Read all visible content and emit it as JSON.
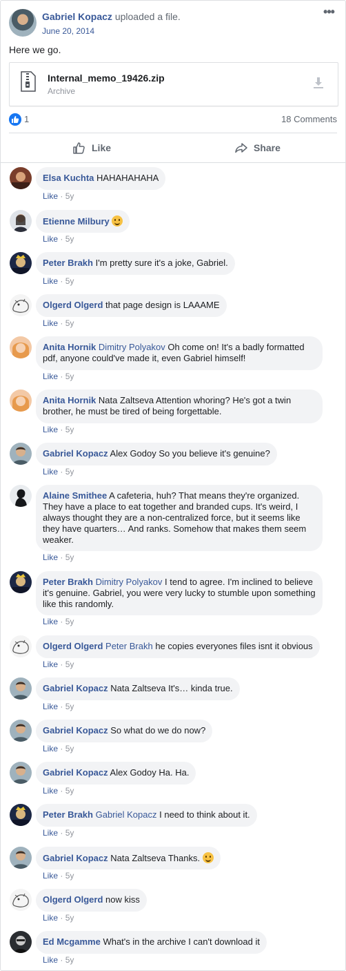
{
  "post": {
    "author": "Gabriel Kopacz",
    "action": "uploaded a file.",
    "date": "June 20, 2014",
    "text": "Here we go.",
    "file_name": "Internal_memo_19426.zip",
    "file_type": "Archive",
    "like_count": "1",
    "comment_count": "18 Comments",
    "like_label": "Like",
    "share_label": "Share",
    "more_label": "•••"
  },
  "comments": [
    {
      "author": "Elsa Kuchta",
      "mention": "",
      "text": "HAHAHAHAHA",
      "like": "Like",
      "time": "5y"
    },
    {
      "author": "Etienne Milbury",
      "mention": "",
      "text": "",
      "like": "Like",
      "time": "5y"
    },
    {
      "author": "Peter Brakh",
      "mention": "",
      "text": "I'm pretty sure it's a joke, Gabriel.",
      "like": "Like",
      "time": "5y"
    },
    {
      "author": "Olgerd Olgerd",
      "mention": "",
      "text": "that page design is LAAAME",
      "like": "Like",
      "time": "5y"
    },
    {
      "author": "Anita Hornik",
      "mention": "Dimitry Polyakov",
      "text": "Oh come on! It's a badly formatted pdf, anyone could've made it, even Gabriel himself!",
      "like": "Like",
      "time": "5y"
    },
    {
      "author": "Anita Hornik",
      "mention": "",
      "text": "Nata Zaltseva Attention whoring? He's got a twin brother, he must be tired of being forgettable.",
      "like": "Like",
      "time": "5y"
    },
    {
      "author": "Gabriel Kopacz",
      "mention": "",
      "text": "Alex Godoy So you believe it's genuine?",
      "like": "Like",
      "time": "5y"
    },
    {
      "author": "Alaine Smithee",
      "mention": "",
      "text": "A cafeteria, huh? That means they're organized. They have a place to eat together and branded cups. It's weird, I always thought they are a non-centralized force, but it seems like they have quarters… And ranks. Somehow that makes them seem weaker.",
      "like": "Like",
      "time": "5y"
    },
    {
      "author": "Peter Brakh",
      "mention": "Dimitry Polyakov",
      "text": "I tend to agree. I'm inclined to believe it's genuine. Gabriel, you were very lucky to stumble upon something like this randomly.",
      "like": "Like",
      "time": "5y"
    },
    {
      "author": "Olgerd Olgerd",
      "mention": "Peter Brakh",
      "text": "he copies everyones files isnt it obvious",
      "like": "Like",
      "time": "5y"
    },
    {
      "author": "Gabriel Kopacz",
      "mention": "",
      "text": "Nata Zaltseva It's… kinda true.",
      "like": "Like",
      "time": "5y"
    },
    {
      "author": "Gabriel Kopacz",
      "mention": "",
      "text": "So what do we do now?",
      "like": "Like",
      "time": "5y"
    },
    {
      "author": "Gabriel Kopacz",
      "mention": "",
      "text": "Alex Godoy Ha. Ha.",
      "like": "Like",
      "time": "5y"
    },
    {
      "author": "Peter Brakh",
      "mention": "Gabriel Kopacz",
      "text": "I need to think about it.",
      "like": "Like",
      "time": "5y"
    },
    {
      "author": "Gabriel Kopacz",
      "mention": "",
      "text": "Nata Zaltseva Thanks.",
      "like": "Like",
      "time": "5y"
    },
    {
      "author": "Olgerd Olgerd",
      "mention": "",
      "text": "now kiss",
      "like": "Like",
      "time": "5y"
    },
    {
      "author": "Ed Mcgamme",
      "mention": "",
      "text": "What's in the archive I can't download it",
      "like": "Like",
      "time": "5y"
    }
  ]
}
